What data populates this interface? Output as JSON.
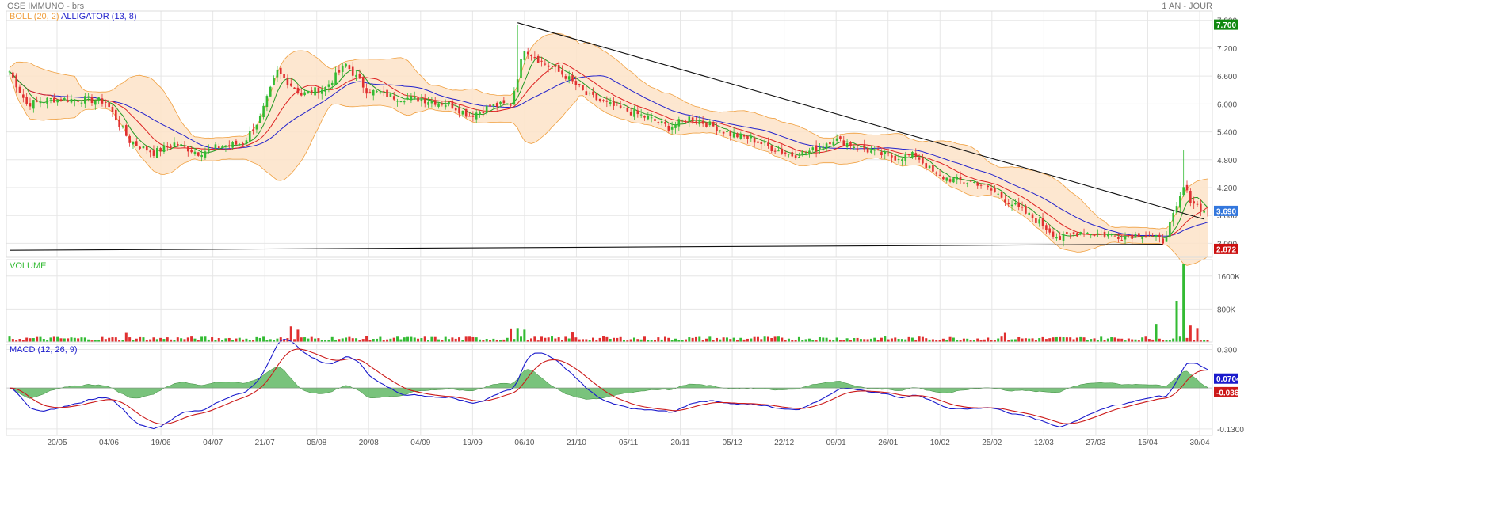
{
  "header": {
    "title": "OSE IMMUNO - brs",
    "period": "1 AN - JOUR"
  },
  "indicators": {
    "boll": "BOLL (20, 2)",
    "alligator": "ALLIGATOR (13, 8)",
    "volume": "VOLUME",
    "macd": "MACD (12, 26, 9)"
  },
  "colors": {
    "up": "#33bb33",
    "down": "#e03030",
    "boll_fill": "#fde3c8",
    "boll_line": "#f0a040",
    "alligator_jaw": "#2222cc",
    "alligator_teeth": "#dd2222",
    "alligator_lips": "#229922",
    "macd_line": "#1a1acc",
    "signal_line": "#cc1a1a",
    "histogram": "#4caf50",
    "grid": "#e6e6e6",
    "badge_last": "#3377dd",
    "badge_high": "#118811",
    "badge_low": "#cc1111"
  },
  "chart_data": [
    {
      "type": "candlestick",
      "name": "price",
      "x_ticks": [
        "20/05",
        "04/06",
        "19/06",
        "04/07",
        "21/07",
        "05/08",
        "20/08",
        "04/09",
        "19/09",
        "06/10",
        "21/10",
        "05/11",
        "20/11",
        "05/12",
        "22/12",
        "09/01",
        "26/01",
        "10/02",
        "25/02",
        "12/03",
        "27/03",
        "15/04",
        "30/04"
      ],
      "y_ticks": [
        "7.800",
        "7.200",
        "6.600",
        "6.000",
        "5.400",
        "4.800",
        "4.200",
        "3.600",
        "3.000"
      ],
      "ylim": [
        2.7,
        8.0
      ],
      "badges": {
        "high": "7.700",
        "last": "3.690",
        "low": "2.872"
      },
      "close_anchors": [
        [
          0,
          6.7
        ],
        [
          5,
          6.0
        ],
        [
          12,
          6.1
        ],
        [
          22,
          6.1
        ],
        [
          28,
          6.05
        ],
        [
          35,
          5.2
        ],
        [
          42,
          4.95
        ],
        [
          48,
          5.15
        ],
        [
          55,
          4.95
        ],
        [
          62,
          5.1
        ],
        [
          68,
          5.15
        ],
        [
          73,
          5.7
        ],
        [
          78,
          6.7
        ],
        [
          85,
          6.2
        ],
        [
          92,
          6.35
        ],
        [
          98,
          6.85
        ],
        [
          104,
          6.3
        ],
        [
          112,
          6.15
        ],
        [
          120,
          6.1
        ],
        [
          128,
          6.0
        ],
        [
          134,
          5.75
        ],
        [
          140,
          5.95
        ],
        [
          146,
          6.0
        ],
        [
          150,
          7.2
        ],
        [
          155,
          6.9
        ],
        [
          162,
          6.6
        ],
        [
          168,
          6.2
        ],
        [
          174,
          6.0
        ],
        [
          180,
          5.85
        ],
        [
          186,
          5.7
        ],
        [
          192,
          5.5
        ],
        [
          198,
          5.7
        ],
        [
          204,
          5.55
        ],
        [
          210,
          5.35
        ],
        [
          216,
          5.25
        ],
        [
          222,
          5.05
        ],
        [
          228,
          4.9
        ],
        [
          234,
          5.0
        ],
        [
          240,
          5.25
        ],
        [
          246,
          5.1
        ],
        [
          252,
          4.95
        ],
        [
          258,
          4.85
        ],
        [
          264,
          4.9
        ],
        [
          270,
          4.45
        ],
        [
          276,
          4.35
        ],
        [
          282,
          4.3
        ],
        [
          288,
          4.05
        ],
        [
          294,
          3.75
        ],
        [
          300,
          3.45
        ],
        [
          306,
          3.1
        ],
        [
          312,
          3.25
        ],
        [
          318,
          3.2
        ],
        [
          324,
          3.15
        ],
        [
          330,
          3.2
        ],
        [
          336,
          3.05
        ],
        [
          340,
          3.75
        ],
        [
          342,
          4.2
        ],
        [
          344,
          3.95
        ],
        [
          348,
          3.69
        ]
      ],
      "trendlines": [
        {
          "from": [
            148,
            7.75
          ],
          "to": [
            348,
            3.52
          ]
        },
        {
          "from": [
            0,
            2.85
          ],
          "to": [
            336,
            2.98
          ]
        }
      ],
      "boll": {
        "period": 20,
        "mult": 2
      },
      "alligator": {
        "jaw": 26,
        "teeth": 13,
        "lips": 6
      }
    },
    {
      "type": "bar",
      "name": "volume",
      "y_ticks": [
        "1600K",
        "800K"
      ],
      "ylim": [
        0,
        2000
      ],
      "spikes": [
        [
          34,
          220
        ],
        [
          82,
          380
        ],
        [
          84,
          300
        ],
        [
          146,
          330
        ],
        [
          148,
          340
        ],
        [
          150,
          300
        ],
        [
          164,
          230
        ],
        [
          290,
          220
        ],
        [
          334,
          440
        ],
        [
          340,
          1000
        ],
        [
          342,
          1900
        ],
        [
          344,
          400
        ],
        [
          346,
          340
        ]
      ],
      "base": 90
    },
    {
      "type": "area",
      "name": "macd",
      "y_ticks": [
        "0.300",
        "-0.1300"
      ],
      "ylim": [
        -0.37,
        0.34
      ],
      "badges": {
        "macd": "0.0704",
        "signal": "-0.0361"
      }
    }
  ]
}
